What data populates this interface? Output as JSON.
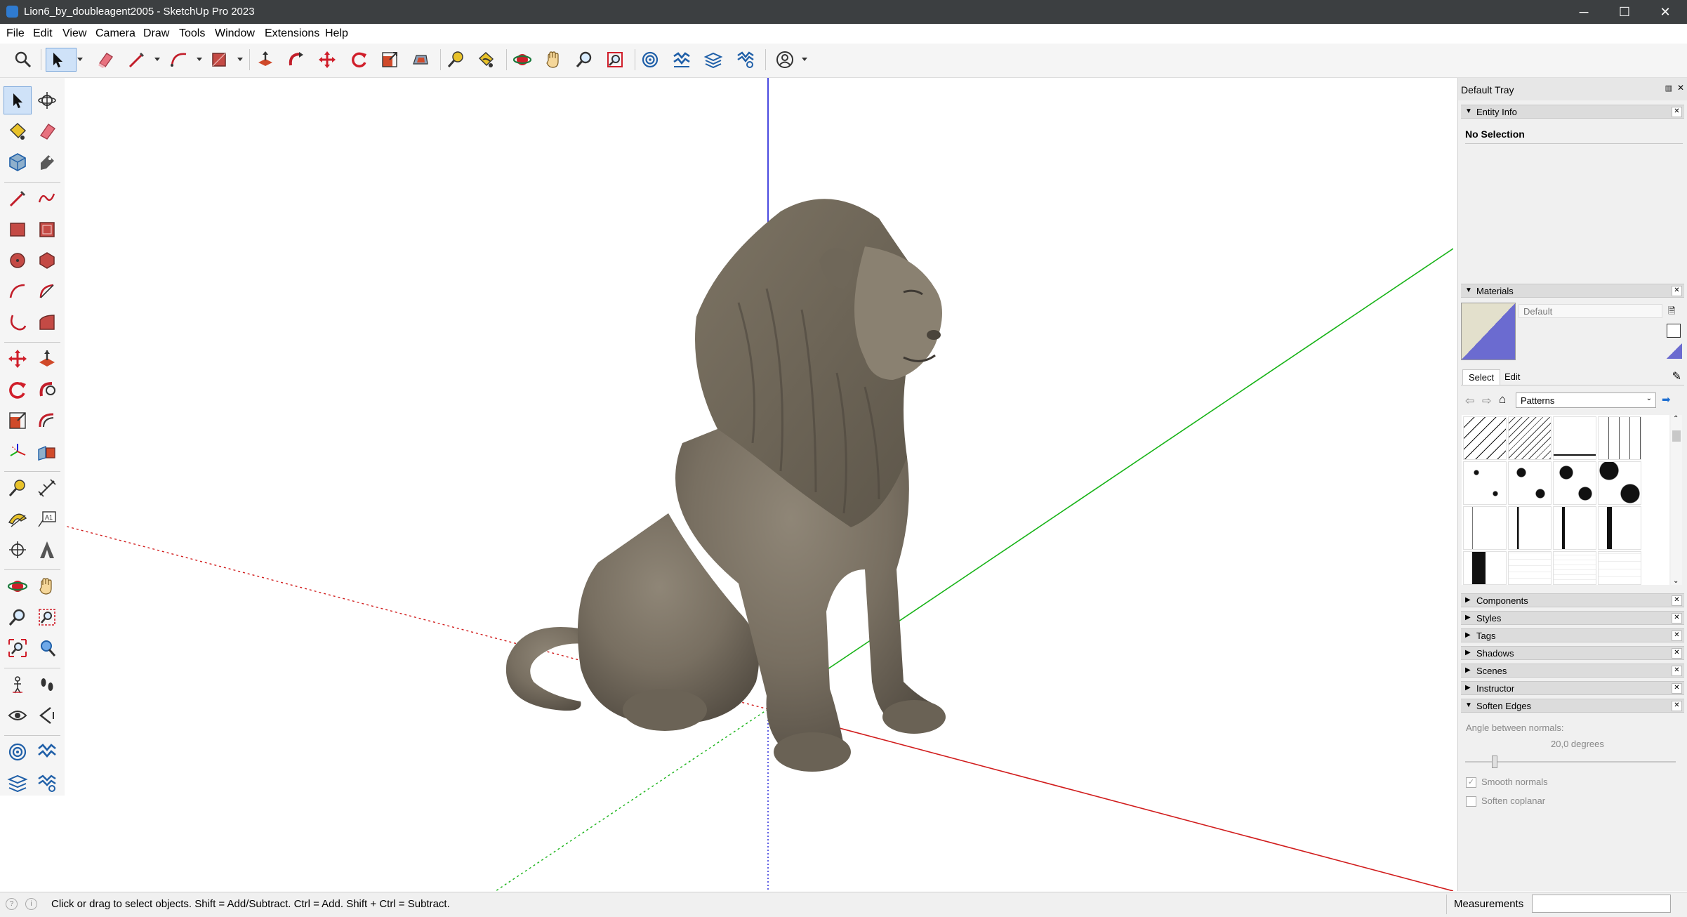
{
  "window": {
    "title": "Lion6_by_doubleagent2005 - SketchUp Pro 2023",
    "minimize": "─",
    "maximize": "☐",
    "close": "✕"
  },
  "menu": [
    "File",
    "Edit",
    "View",
    "Camera",
    "Draw",
    "Tools",
    "Window",
    "Extensions",
    "Help"
  ],
  "toolbar": {
    "icons": [
      "search-icon",
      "select-icon",
      "eraser-icon",
      "pencil-line-icon",
      "arc-icon",
      "rectangle-icon",
      "push-pull-icon",
      "follow-me-icon",
      "move-icon",
      "rotate-icon",
      "scale-icon",
      "offset-icon",
      "tape-measure-icon",
      "paint-bucket-icon",
      "orbit-icon",
      "pan-icon",
      "zoom-icon",
      "zoom-extents-icon",
      "sandbox-from-contours-icon",
      "sandbox-smoove-icon",
      "sandbox-stamp-icon",
      "sandbox-drape-icon",
      "account-icon"
    ]
  },
  "left_toolbar": {
    "icons": [
      "select-icon",
      "orbit-icon",
      "paint-bucket-icon",
      "eraser-icon",
      "component-icon",
      "tag-icon",
      "line-icon",
      "freehand-icon",
      "rectangle-icon",
      "rotated-rectangle-icon",
      "circle-icon",
      "polygon-icon",
      "arc-icon",
      "pie-icon",
      "two-point-arc-icon",
      "three-point-arc-icon",
      "move-icon",
      "push-pull-icon",
      "rotate-icon",
      "follow-me-icon",
      "scale-icon",
      "offset-icon",
      "axes-icon",
      "section-plane-icon",
      "tape-measure-icon",
      "dimension-icon",
      "protractor-icon",
      "text-icon",
      "axes-tool-icon",
      "3d-text-icon",
      "orbit-tool-icon",
      "pan-tool-icon",
      "zoom-tool-icon",
      "zoom-window-icon",
      "zoom-extents-tool-icon",
      "previous-view-icon",
      "position-camera-icon",
      "walk-icon",
      "look-around-icon",
      "section-display-icon",
      "sandbox-contours-icon",
      "sandbox-scratch-icon",
      "sandbox-stamp-tool-icon",
      "sandbox-flip-icon"
    ]
  },
  "tray": {
    "title": "Default Tray",
    "entity_info": {
      "label": "Entity Info",
      "value": "No Selection"
    },
    "materials": {
      "label": "Materials",
      "name": "Default",
      "tabs": [
        "Select",
        "Edit"
      ],
      "collection": "Patterns"
    },
    "collapsed_panels": [
      "Components",
      "Styles",
      "Tags",
      "Shadows",
      "Scenes",
      "Instructor"
    ],
    "soften_edges": {
      "label": "Soften Edges",
      "angle_label": "Angle between normals:",
      "angle_value": "20,0  degrees",
      "angle_fraction": 0.13,
      "smooth_normals": "Smooth normals",
      "smooth_normals_checked": true,
      "soften_coplanar": "Soften coplanar",
      "soften_coplanar_checked": false
    }
  },
  "status": {
    "hint": "Click or drag to select objects. Shift = Add/Subtract. Ctrl = Add. Shift + Ctrl = Subtract.",
    "measurements_label": "Measurements",
    "measurements_value": ""
  },
  "colors": {
    "red_axis": "#d11d1d",
    "green_axis": "#17b317",
    "blue_axis": "#1c1cd8",
    "lion_stone": "#7c7365",
    "accent": "#1f6fd1"
  }
}
